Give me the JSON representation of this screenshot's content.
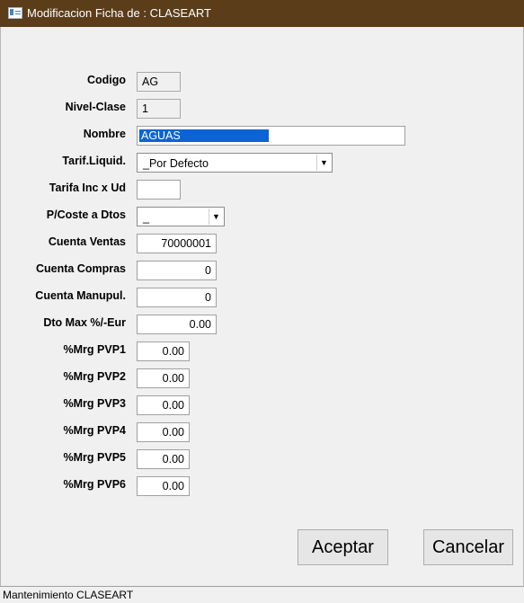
{
  "window": {
    "title": "Modificacion Ficha de : CLASEART",
    "icon": "window-icon"
  },
  "form": {
    "codigo": {
      "label": "Codigo",
      "value": "AG"
    },
    "nivel_clase": {
      "label": "Nivel-Clase",
      "value": "1"
    },
    "nombre": {
      "label": "Nombre",
      "value": "AGUAS"
    },
    "tarif_liquid": {
      "label": "Tarif.Liquid.",
      "value": "_Por Defecto"
    },
    "tarifa_inc": {
      "label": "Tarifa Inc x Ud",
      "value": ""
    },
    "pcoste_dtos": {
      "label": "P/Coste a Dtos",
      "value": "_"
    },
    "cuenta_ventas": {
      "label": "Cuenta Ventas",
      "value": "70000001"
    },
    "cuenta_compras": {
      "label": "Cuenta Compras",
      "value": "0"
    },
    "cuenta_manupul": {
      "label": "Cuenta Manupul.",
      "value": "0"
    },
    "dto_max": {
      "label": "Dto Max %/-Eur",
      "value": "0.00"
    },
    "mrg_pvp": [
      {
        "label": "%Mrg PVP1",
        "value": "0.00"
      },
      {
        "label": "%Mrg PVP2",
        "value": "0.00"
      },
      {
        "label": "%Mrg PVP3",
        "value": "0.00"
      },
      {
        "label": "%Mrg PVP4",
        "value": "0.00"
      },
      {
        "label": "%Mrg PVP5",
        "value": "0.00"
      },
      {
        "label": "%Mrg PVP6",
        "value": "0.00"
      }
    ]
  },
  "buttons": {
    "accept": "Aceptar",
    "cancel": "Cancelar"
  },
  "status": {
    "text": "Mantenimiento CLASEART"
  },
  "colors": {
    "titlebar": "#5b3d1a",
    "selection": "#0a64d6",
    "background": "#f0f0f0"
  }
}
